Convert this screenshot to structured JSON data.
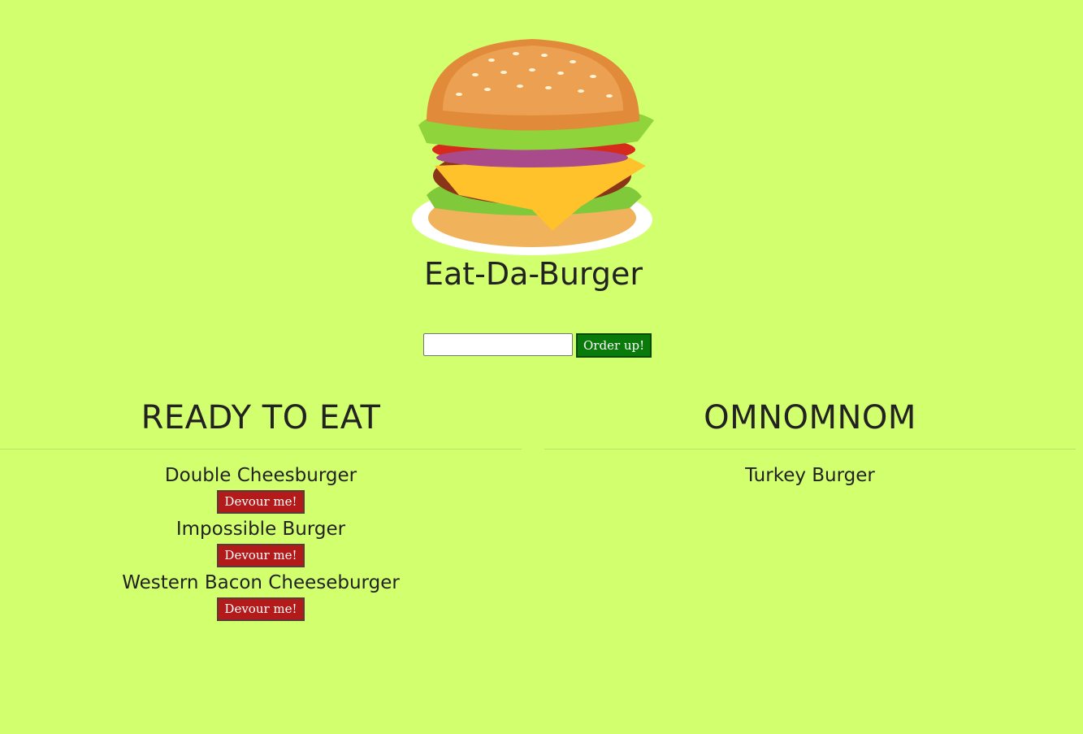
{
  "header": {
    "title": "Eat-Da-Burger",
    "logo_icon": "burger-icon"
  },
  "order_form": {
    "input_value": "",
    "submit_label": "Order up!"
  },
  "ready": {
    "title": "READY TO EAT",
    "burgers": [
      {
        "name": "Double Cheesburger",
        "button": "Devour me!"
      },
      {
        "name": "Impossible Burger",
        "button": "Devour me!"
      },
      {
        "name": "Western Bacon Cheeseburger",
        "button": "Devour me!"
      }
    ]
  },
  "devoured": {
    "title": "OMNOMNOM",
    "burgers": [
      {
        "name": "Turkey Burger"
      }
    ]
  },
  "colors": {
    "background": "#d2ff6e",
    "order_button": "#0a7a0a",
    "devour_button": "#b31b1b"
  }
}
